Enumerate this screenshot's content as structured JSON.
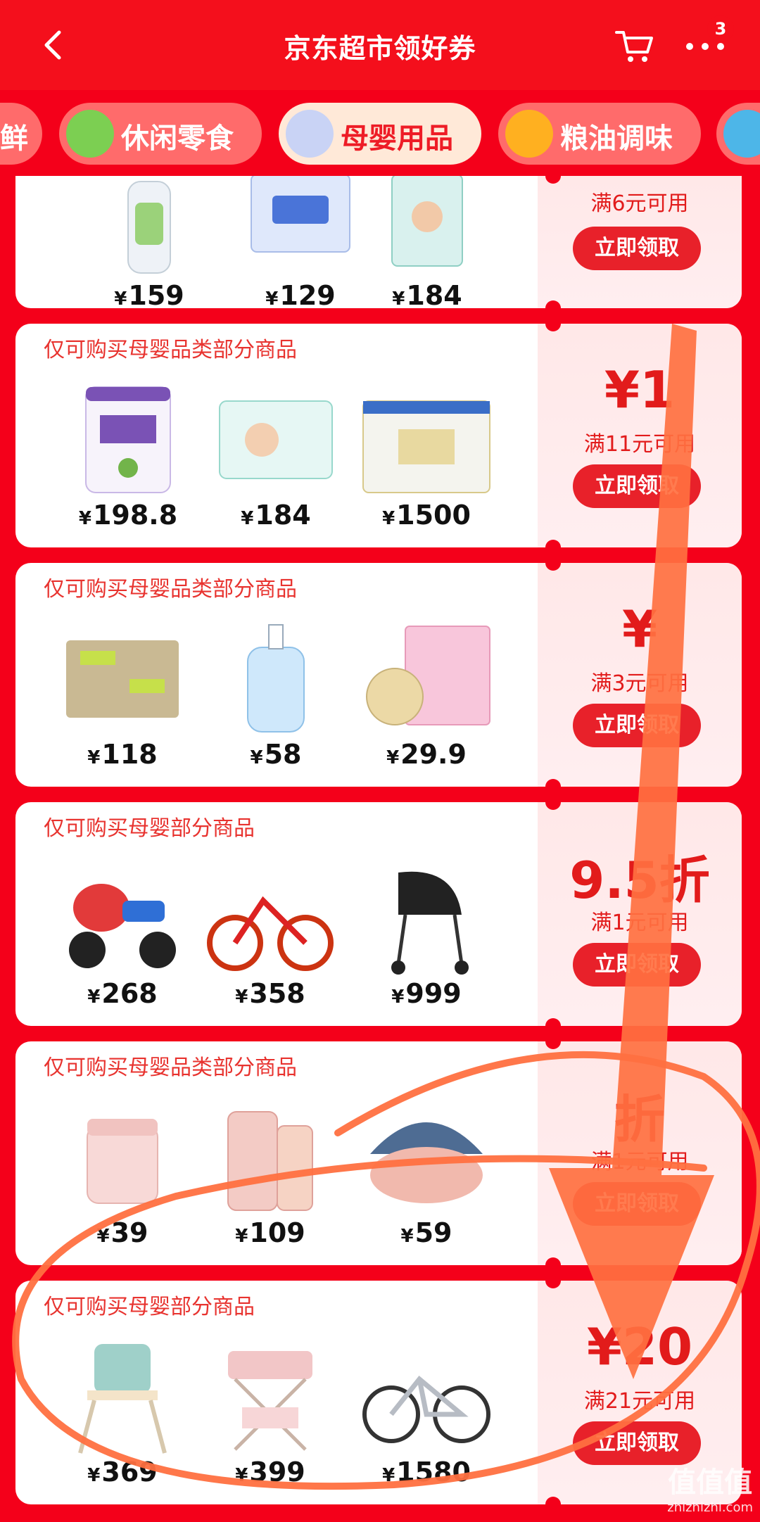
{
  "header": {
    "title": "京东超市领好券",
    "badge": "3"
  },
  "categories": [
    {
      "label": "鲜",
      "active": false
    },
    {
      "label": "休闲零食",
      "active": false
    },
    {
      "label": "母婴用品",
      "active": true
    },
    {
      "label": "粮油调味",
      "active": false
    }
  ],
  "cards": [
    {
      "header": "",
      "products": [
        {
          "price": "159"
        },
        {
          "price": "129"
        },
        {
          "price": "184"
        }
      ],
      "amount": "",
      "condition": "满6元可用",
      "button": "立即领取"
    },
    {
      "header": "仅可购买母婴品类部分商品",
      "products": [
        {
          "price": "198.8"
        },
        {
          "price": "184"
        },
        {
          "price": "1500"
        }
      ],
      "amount": "¥1",
      "condition": "满11元可用",
      "button": "立即领取"
    },
    {
      "header": "仅可购买母婴品类部分商品",
      "products": [
        {
          "price": "118"
        },
        {
          "price": "58"
        },
        {
          "price": "29.9"
        }
      ],
      "amount": "¥",
      "condition": "满3元可用",
      "button": "立即领取"
    },
    {
      "header": "仅可购买母婴部分商品",
      "products": [
        {
          "price": "268"
        },
        {
          "price": "358"
        },
        {
          "price": "999"
        }
      ],
      "amount": "9.5折",
      "condition": "满1元可用",
      "button": "立即领取"
    },
    {
      "header": "仅可购买母婴品类部分商品",
      "products": [
        {
          "price": "39"
        },
        {
          "price": "109"
        },
        {
          "price": "59"
        }
      ],
      "amount": "折",
      "condition": "满1元可用",
      "button": "立即领取"
    },
    {
      "header": "仅可购买母婴部分商品",
      "products": [
        {
          "price": "369"
        },
        {
          "price": "399"
        },
        {
          "price": "1580"
        }
      ],
      "amount": "¥20",
      "condition": "满21元可用",
      "button": "立即领取"
    }
  ],
  "watermark": {
    "text": "值值值",
    "sub": "zhizhizhi.com"
  },
  "colors": {
    "accent": "#e8212a",
    "bg": "#f4001a",
    "annotation": "#ff7040"
  }
}
